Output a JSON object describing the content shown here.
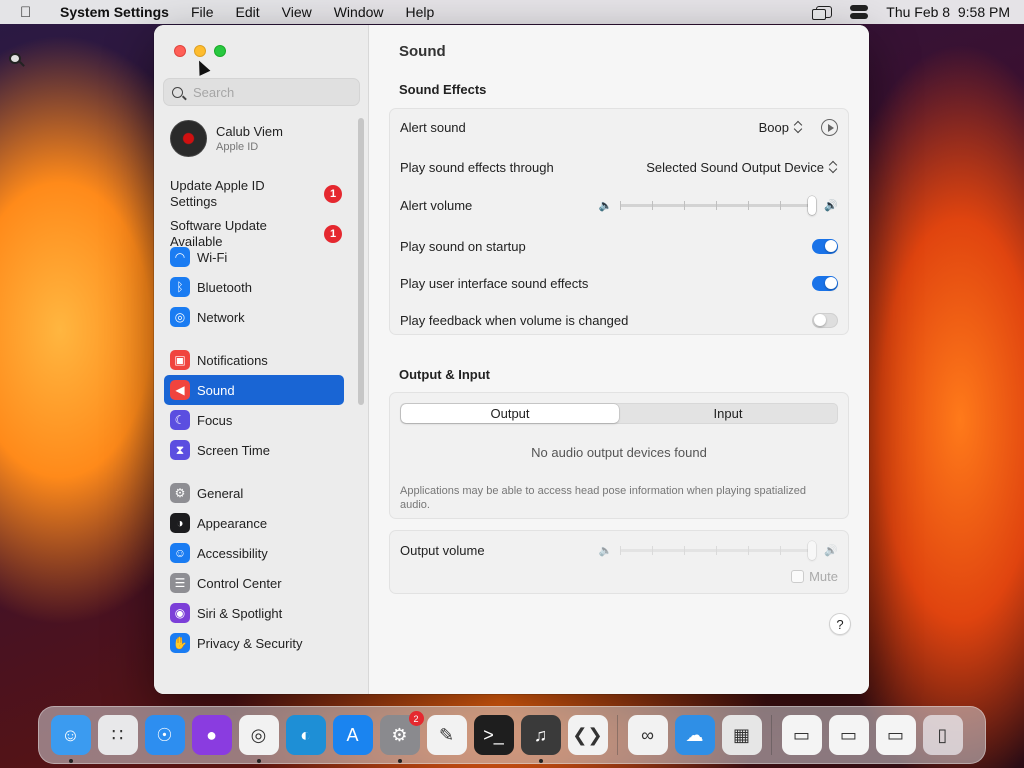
{
  "menubar": {
    "app_name": "System Settings",
    "menus": [
      "File",
      "Edit",
      "View",
      "Window",
      "Help"
    ],
    "clock": "Thu Feb 8  9:58 PM"
  },
  "sidebar": {
    "search_placeholder": "Search",
    "account": {
      "name": "Calub Viem",
      "subtitle": "Apple ID"
    },
    "notices": [
      {
        "label": "Update Apple ID Settings",
        "badge": "1"
      },
      {
        "label": "Software Update Available",
        "badge": "1"
      }
    ],
    "items": [
      {
        "label": "Wi-Fi",
        "icon": "wifi-icon",
        "color": "#1a7cf2"
      },
      {
        "label": "Bluetooth",
        "icon": "bluetooth-icon",
        "color": "#1a7cf2"
      },
      {
        "label": "Network",
        "icon": "network-globe-icon",
        "color": "#1a7cf2"
      },
      {
        "label": "Notifications",
        "icon": "notifications-bell-icon",
        "color": "#f0443e"
      },
      {
        "label": "Sound",
        "icon": "sound-speaker-icon",
        "color": "#f0443e",
        "active": true
      },
      {
        "label": "Focus",
        "icon": "focus-moon-icon",
        "color": "#5b4ee0"
      },
      {
        "label": "Screen Time",
        "icon": "screen-time-hourglass-icon",
        "color": "#5b4ee0"
      },
      {
        "label": "General",
        "icon": "general-gear-icon",
        "color": "#8e8e93"
      },
      {
        "label": "Appearance",
        "icon": "appearance-icon",
        "color": "#1c1c1e"
      },
      {
        "label": "Accessibility",
        "icon": "accessibility-icon",
        "color": "#1a7cf2"
      },
      {
        "label": "Control Center",
        "icon": "control-center-icon",
        "color": "#8e8e93"
      },
      {
        "label": "Siri & Spotlight",
        "icon": "siri-icon",
        "color": "#7c3fd8"
      },
      {
        "label": "Privacy & Security",
        "icon": "privacy-hand-icon",
        "color": "#1a7cf2"
      }
    ]
  },
  "content": {
    "title": "Sound",
    "sound_effects": {
      "heading": "Sound Effects",
      "alert_sound_label": "Alert sound",
      "alert_sound_value": "Boop",
      "play_through_label": "Play sound effects through",
      "play_through_value": "Selected Sound Output Device",
      "alert_volume_label": "Alert volume",
      "alert_volume": 1.0,
      "startup_label": "Play sound on startup",
      "startup_on": true,
      "ui_effects_label": "Play user interface sound effects",
      "ui_effects_on": true,
      "feedback_label": "Play feedback when volume is changed",
      "feedback_on": false
    },
    "output_input": {
      "heading": "Output & Input",
      "tabs": [
        "Output",
        "Input"
      ],
      "selected_tab": "Output",
      "empty_message": "No audio output devices found",
      "footnote": "Applications may be able to access head pose information when playing spatialized audio."
    },
    "output_volume": {
      "label": "Output volume",
      "value": 1.0,
      "mute_label": "Mute"
    },
    "help_label": "?"
  },
  "dock": {
    "apps": [
      {
        "name": "Finder",
        "icon": "finder-icon",
        "color": "#3b9bf0",
        "running": true
      },
      {
        "name": "Launchpad",
        "icon": "launchpad-icon",
        "color": "#e8e8ea",
        "running": false
      },
      {
        "name": "Safari",
        "icon": "safari-compass-icon",
        "color": "#2d8ef0",
        "running": false
      },
      {
        "name": "Firefox",
        "icon": "firefox-icon",
        "color": "#8a3ce0",
        "running": false
      },
      {
        "name": "Chrome",
        "icon": "chrome-icon",
        "color": "#f2f2f2",
        "running": true
      },
      {
        "name": "Edge",
        "icon": "edge-icon",
        "color": "#1e8fd6",
        "running": false
      },
      {
        "name": "App Store",
        "icon": "app-store-icon",
        "color": "#1a84f0",
        "running": false
      },
      {
        "name": "System Settings",
        "icon": "system-settings-gear-icon",
        "color": "#8a8a8e",
        "running": true,
        "badge": "2"
      },
      {
        "name": "TextEdit",
        "icon": "textedit-icon",
        "color": "#f2f2f2",
        "running": false
      },
      {
        "name": "Terminal",
        "icon": "terminal-icon",
        "color": "#1e1e1e",
        "running": false
      },
      {
        "name": "GarageBand",
        "icon": "garageband-guitar-icon",
        "color": "#3a3a3a",
        "running": true
      },
      {
        "name": "VS Code",
        "icon": "vscode-icon",
        "color": "#f2f2f2",
        "running": false
      },
      {
        "name": "Visual Studio",
        "icon": "visual-studio-icon",
        "color": "#f2f2f2",
        "running": false
      },
      {
        "name": "Weather",
        "icon": "weather-cloud-icon",
        "color": "#2f8fe6",
        "running": false
      },
      {
        "name": "Boot Camp",
        "icon": "boot-camp-icon",
        "color": "#e6e6e6",
        "running": false
      }
    ],
    "recent": [
      {
        "name": "Recent window 1",
        "icon": "window-thumbnail-icon"
      },
      {
        "name": "Recent window 2",
        "icon": "window-thumbnail-icon"
      },
      {
        "name": "Recent window 3",
        "icon": "window-thumbnail-icon"
      }
    ],
    "trash": {
      "name": "Trash",
      "icon": "trash-icon"
    }
  }
}
